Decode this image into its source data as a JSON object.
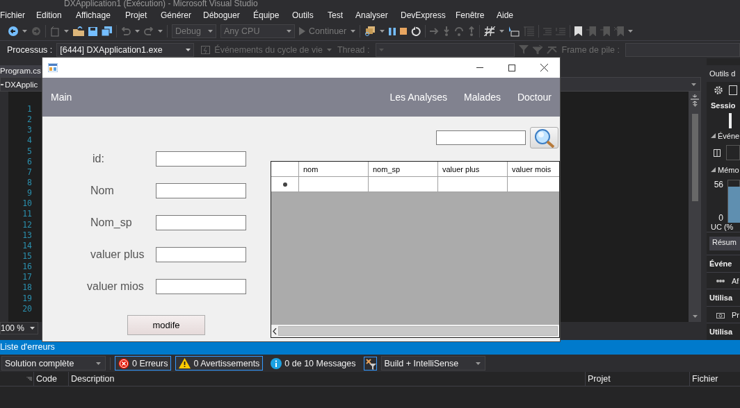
{
  "window": {
    "title": "DXApplication1 (Exécution) - Microsoft Visual Studio"
  },
  "menu": [
    "Fichier",
    "Edition",
    "Affichage",
    "Projet",
    "Générer",
    "Déboguer",
    "Équipe",
    "Outils",
    "Test",
    "Analyser",
    "DevExpress",
    "Fenêtre",
    "Aide"
  ],
  "toolbar": {
    "configuration": "Debug",
    "platform": "Any CPU",
    "start": "Continuer"
  },
  "debug_location": {
    "process_label": "Processus :",
    "process": "[6444] DXApplication1.exe",
    "lifecycle": "Événements du cycle de vie",
    "thread_label": "Thread :",
    "frame_label": "Frame de pile :"
  },
  "editor": {
    "tab": "Program.cs",
    "navigation": "DXApplic",
    "line_numbers": [
      "1",
      "2",
      "3",
      "4",
      "5",
      "6",
      "7",
      "8",
      "9",
      "10",
      "11",
      "12",
      "13",
      "14",
      "15",
      "16",
      "17",
      "18",
      "19",
      "20"
    ],
    "zoom": "100 %"
  },
  "diagnostics": {
    "title": "Outils d",
    "session": "Sessio",
    "events": "Événe",
    "memory": "Mémo",
    "memory_max": "56",
    "memory_min": "0",
    "cpu": "UC (%",
    "tab": "Résum",
    "sections": [
      {
        "heading": "Événe",
        "item": "Af",
        "kind": "events"
      },
      {
        "heading": "Utilisa",
        "item": "Pr",
        "kind": "snapshot"
      },
      {
        "heading": "Utilisa"
      }
    ]
  },
  "app_form": {
    "nav_left": "Main",
    "nav": [
      "Les Analyses",
      "Malades",
      "Doctour"
    ],
    "fields": [
      {
        "label": "id:"
      },
      {
        "label": "Nom"
      },
      {
        "label": "Nom_sp"
      },
      {
        "label": "valuer plus"
      },
      {
        "label": "valuer mios"
      }
    ],
    "button": "modife",
    "grid": {
      "columns": [
        "nom",
        "nom_sp",
        "valuer plus",
        "valuer mois"
      ]
    }
  },
  "error_list": {
    "title": "Liste d'erreurs",
    "scope": "Solution complète",
    "filters": [
      {
        "kind": "errors",
        "label": "0 Erreurs",
        "on": true
      },
      {
        "kind": "warnings",
        "label": "0 Avertissements",
        "on": true
      },
      {
        "kind": "messages",
        "label": "0 de 10 Messages",
        "on": false
      }
    ],
    "build": "Build + IntelliSense",
    "columns": [
      "Code",
      "Description",
      "Projet",
      "Fichier"
    ]
  }
}
